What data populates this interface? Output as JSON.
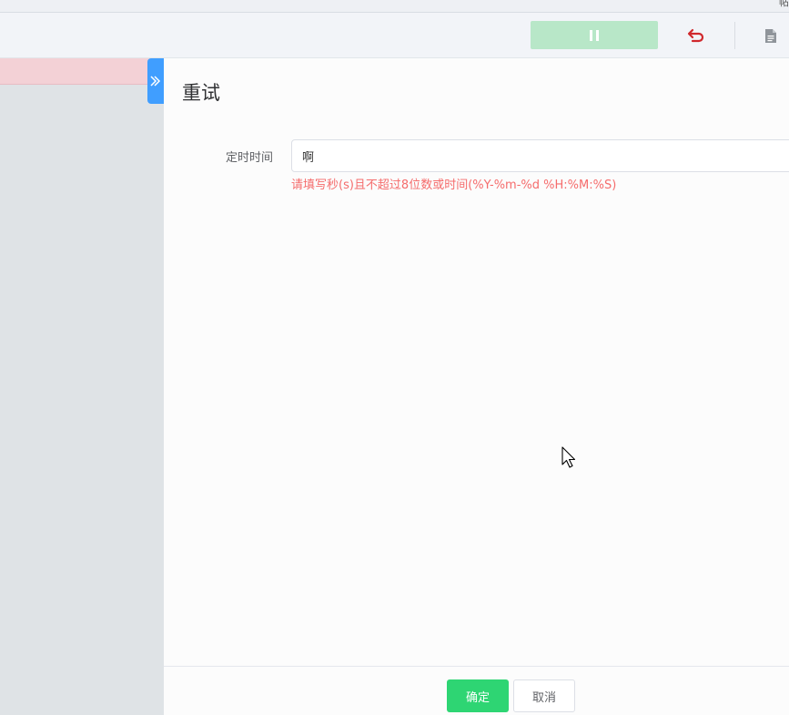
{
  "top_strip": {
    "corner_text": "帖"
  },
  "toolbar": {
    "pause_icon": "pause-icon",
    "undo_icon": "undo-icon",
    "document_icon": "document-icon",
    "pause_color": "#b8e7c8",
    "undo_color": "#d0282c"
  },
  "sidebar": {
    "expand_icon": "double-chevron-right-icon"
  },
  "drawer": {
    "title": "重试",
    "form": {
      "label": "定时时间",
      "value": "啊",
      "error": "请填写秒(s)且不超过8位数或时间(%Y-%m-%d %H:%M:%S)"
    },
    "footer": {
      "confirm_label": "确定",
      "cancel_label": "取消"
    }
  },
  "colors": {
    "primary": "#409eff",
    "success": "#2ed573",
    "danger": "#f56c6c",
    "pink_row": "#f3d1d6"
  }
}
